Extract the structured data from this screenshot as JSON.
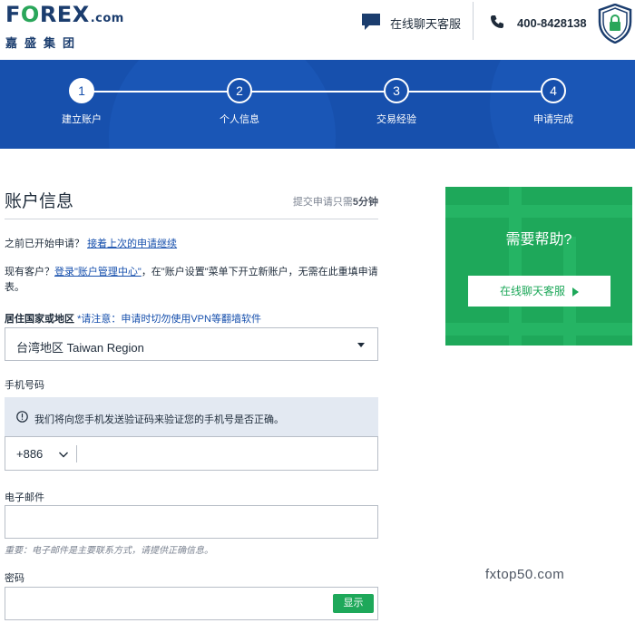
{
  "header": {
    "logo": {
      "text": "FOREX",
      "suffix": ".com",
      "subtitle": "嘉盛集团"
    },
    "chat_label": "在线聊天客服",
    "phone_number": "400-8428138",
    "icons": {
      "chat": "chat-bubble-icon",
      "phone": "phone-icon",
      "security": "shield-lock-icon"
    }
  },
  "steps": [
    {
      "number": "1",
      "label": "建立账户",
      "active": true
    },
    {
      "number": "2",
      "label": "个人信息",
      "active": false
    },
    {
      "number": "3",
      "label": "交易经验",
      "active": false
    },
    {
      "number": "4",
      "label": "申请完成",
      "active": false
    }
  ],
  "form": {
    "title": "账户信息",
    "time_note_prefix": "提交申请只需",
    "time_note_value": "5分钟",
    "resume_prefix": "之前已开始申请？",
    "resume_link": "接着上次的申请继续",
    "existing_prefix": "现有客户？",
    "existing_link": "登录\"账户管理中心\"",
    "existing_suffix": "，在\"账户设置\"菜单下开立新账户，无需在此重填申请表。",
    "country_label": "居住国家或地区",
    "country_warning": "*请注意：申请时切勿使用VPN等翻墙软件",
    "country_value": "台湾地区 Taiwan Region",
    "phone_label": "手机号码",
    "phone_info": "我们将向您手机发送验证码来验证您的手机号是否正确。",
    "phone_code": "+886",
    "phone_value": "",
    "email_label": "电子邮件",
    "email_value": "",
    "email_hint": "重要：电子邮件是主要联系方式，请提供正确信息。",
    "password_label": "密码",
    "password_value": "",
    "show_button": "显示"
  },
  "help_card": {
    "title": "需要帮助?",
    "button": "在线聊天客服"
  },
  "watermark": "fxtop50.com",
  "colors": {
    "brand_blue": "#1750ad",
    "brand_green": "#1ea85a",
    "navy": "#1b3d6e"
  }
}
